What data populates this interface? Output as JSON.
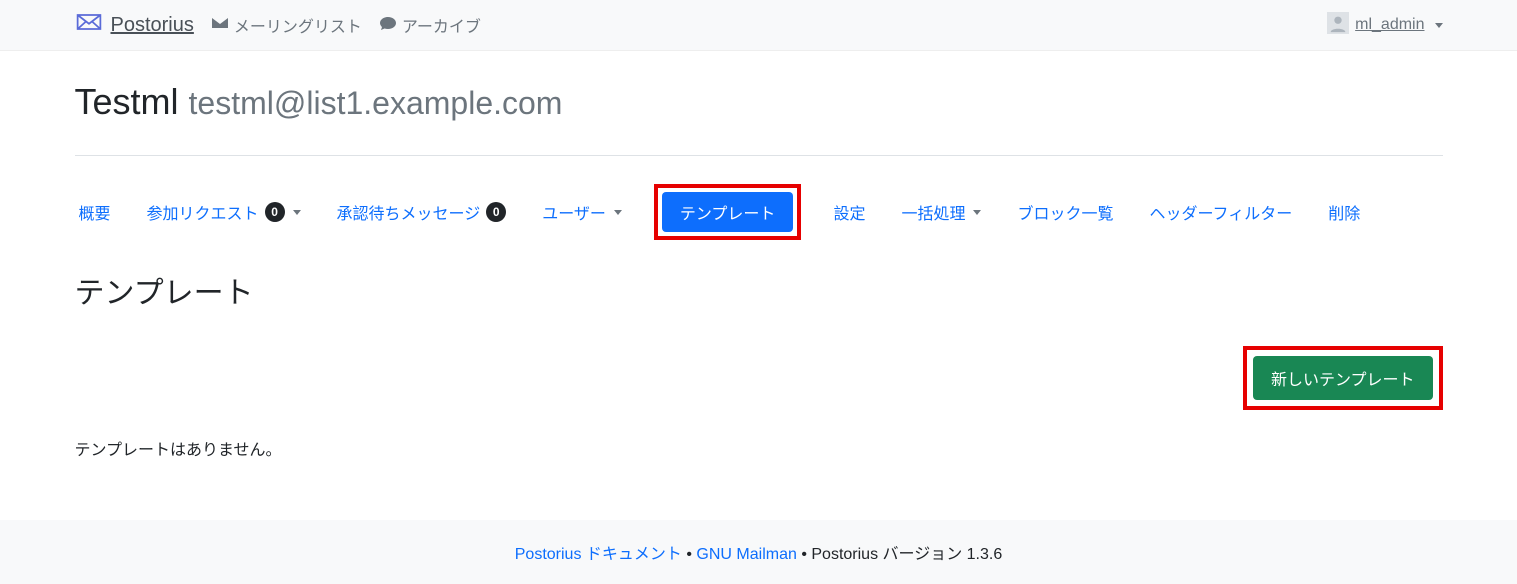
{
  "brand": "Postorius",
  "nav": {
    "mailing_lists": "メーリングリスト",
    "archive": "アーカイブ"
  },
  "user": "ml_admin",
  "list": {
    "name": "Testml",
    "address": "testml@list1.example.com"
  },
  "tabs": {
    "overview": "概要",
    "sub_requests": "参加リクエスト",
    "sub_requests_count": "0",
    "held_messages": "承認待ちメッセージ",
    "held_messages_count": "0",
    "users": "ユーザー",
    "templates": "テンプレート",
    "settings": "設定",
    "mass_ops": "一括処理",
    "ban_list": "ブロック一覧",
    "header_filters": "ヘッダーフィルター",
    "delete": "削除"
  },
  "section": {
    "title": "テンプレート",
    "new_button": "新しいテンプレート",
    "empty": "テンプレートはありません。"
  },
  "footer": {
    "docs": "Postorius ドキュメント",
    "mailman": "GNU Mailman",
    "version_prefix": "Postorius バージョン ",
    "version": "1.3.6",
    "sep": " • "
  }
}
